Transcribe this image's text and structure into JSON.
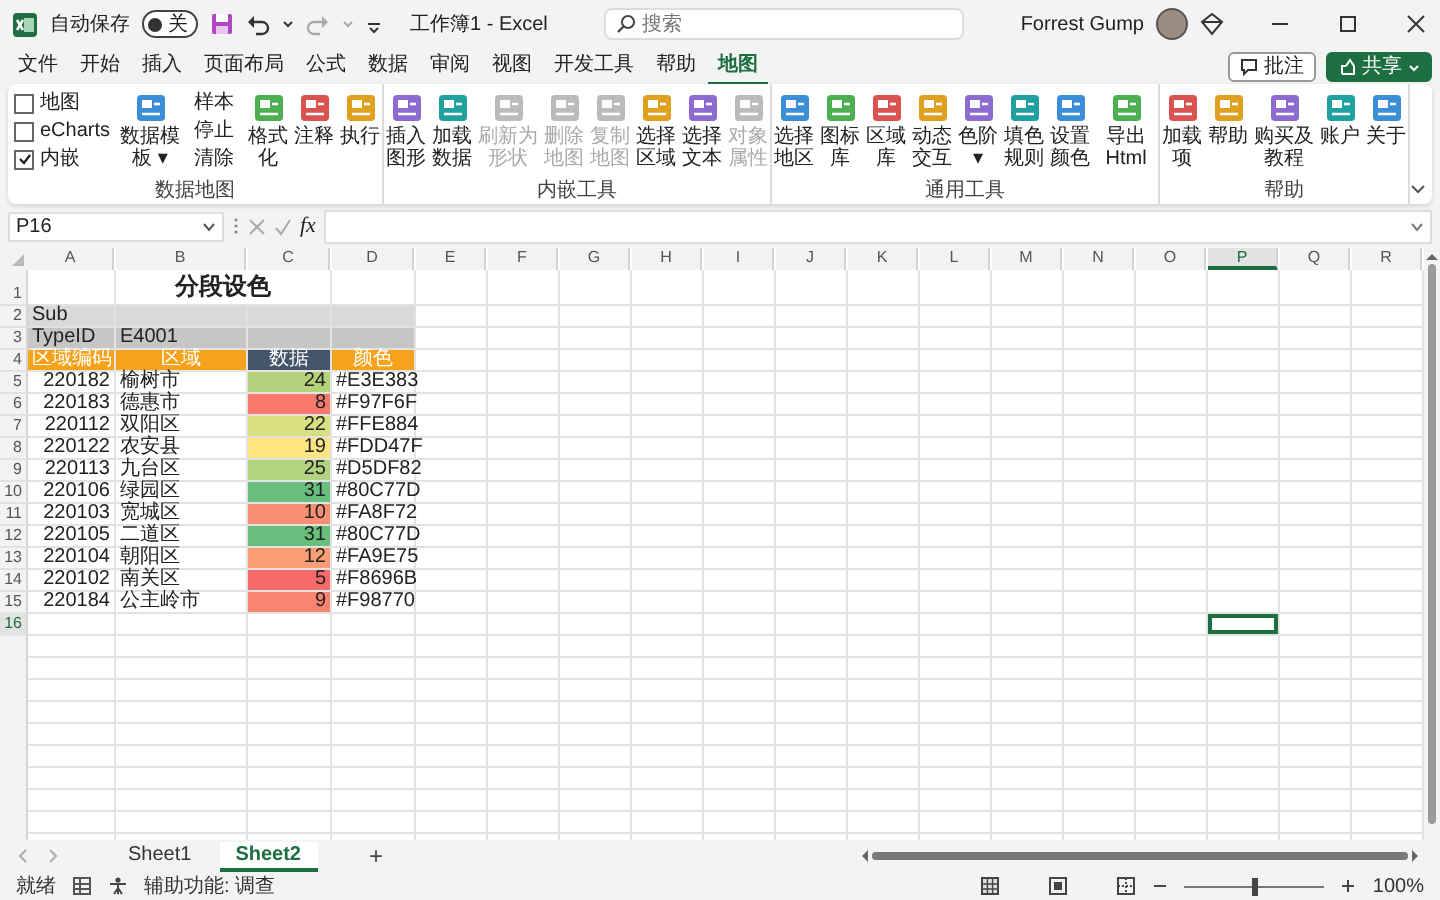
{
  "title_bar": {
    "autosave_label": "自动保存",
    "autosave_state": "关",
    "autosave_on": false,
    "document_title": "工作簿1 - Excel",
    "search_placeholder": "搜索",
    "user_name": "Forrest Gump"
  },
  "ribbon_tabs": [
    {
      "label": "文件",
      "selected": false
    },
    {
      "label": "开始",
      "selected": false
    },
    {
      "label": "插入",
      "selected": false
    },
    {
      "label": "页面布局",
      "selected": false
    },
    {
      "label": "公式",
      "selected": false
    },
    {
      "label": "数据",
      "selected": false
    },
    {
      "label": "审阅",
      "selected": false
    },
    {
      "label": "视图",
      "selected": false
    },
    {
      "label": "开发工具",
      "selected": false
    },
    {
      "label": "帮助",
      "selected": false
    },
    {
      "label": "地图",
      "selected": true
    }
  ],
  "ribbon_actions": [
    {
      "label": "批注",
      "kind": "outline"
    },
    {
      "label": "共享",
      "kind": "primary"
    }
  ],
  "ribbon_groups": [
    {
      "label": "数据地图",
      "items": [
        {
          "kind": "checkbox",
          "label": "地图",
          "checked": false
        },
        {
          "kind": "checkbox",
          "label": "eCharts",
          "checked": false
        },
        {
          "kind": "checkbox",
          "label": "内嵌",
          "checked": true
        },
        {
          "kind": "large",
          "label": "数据模板 ▾",
          "disabled": false
        },
        {
          "kind": "small",
          "label": "样本",
          "disabled": false
        },
        {
          "kind": "small",
          "label": "停止",
          "disabled": false
        },
        {
          "kind": "small",
          "label": "清除",
          "disabled": false
        },
        {
          "kind": "large",
          "label": "格式化",
          "disabled": false
        },
        {
          "kind": "large",
          "label": "注释",
          "disabled": false
        },
        {
          "kind": "large",
          "label": "执行",
          "disabled": false
        }
      ]
    },
    {
      "label": "内嵌工具",
      "items": [
        {
          "kind": "large",
          "label": "插入图形",
          "disabled": false
        },
        {
          "kind": "large",
          "label": "加载数据",
          "disabled": false
        },
        {
          "kind": "large",
          "label": "刷新为形状",
          "disabled": true
        },
        {
          "kind": "large",
          "label": "删除地图",
          "disabled": true
        },
        {
          "kind": "large",
          "label": "复制地图",
          "disabled": true
        },
        {
          "kind": "large",
          "label": "选择区域",
          "disabled": false
        },
        {
          "kind": "large",
          "label": "选择文本",
          "disabled": false
        },
        {
          "kind": "large",
          "label": "对象属性",
          "disabled": true
        }
      ]
    },
    {
      "label": "通用工具",
      "items": [
        {
          "kind": "large",
          "label": "选择地区",
          "disabled": false
        },
        {
          "kind": "large",
          "label": "图标库",
          "disabled": false
        },
        {
          "kind": "large",
          "label": "区域库",
          "disabled": false
        },
        {
          "kind": "large",
          "label": "动态交互",
          "disabled": false
        },
        {
          "kind": "large",
          "label": "色阶 ▾",
          "disabled": false
        },
        {
          "kind": "large",
          "label": "填色规则",
          "disabled": false
        },
        {
          "kind": "large",
          "label": "设置颜色",
          "disabled": false
        },
        {
          "kind": "large",
          "label": "导出Html",
          "disabled": false
        }
      ]
    },
    {
      "label": "帮助",
      "items": [
        {
          "kind": "large",
          "label": "加载项",
          "disabled": false
        },
        {
          "kind": "large",
          "label": "帮助",
          "disabled": false
        },
        {
          "kind": "large",
          "label": "购买及教程",
          "disabled": false
        },
        {
          "kind": "large",
          "label": "账户",
          "disabled": false
        },
        {
          "kind": "large",
          "label": "关于",
          "disabled": false
        }
      ]
    }
  ],
  "formula_bar": {
    "name_box": "P16",
    "function_label": "fx"
  },
  "sheet": {
    "columns": [
      {
        "label": "A",
        "selected": false
      },
      {
        "label": "B",
        "selected": false
      },
      {
        "label": "C",
        "selected": false
      },
      {
        "label": "D",
        "selected": false
      },
      {
        "label": "E",
        "selected": false
      },
      {
        "label": "F",
        "selected": false
      },
      {
        "label": "G",
        "selected": false
      },
      {
        "label": "H",
        "selected": false
      },
      {
        "label": "I",
        "selected": false
      },
      {
        "label": "J",
        "selected": false
      },
      {
        "label": "K",
        "selected": false
      },
      {
        "label": "L",
        "selected": false
      },
      {
        "label": "M",
        "selected": false
      },
      {
        "label": "N",
        "selected": false
      },
      {
        "label": "O",
        "selected": false
      },
      {
        "label": "P",
        "selected": true
      },
      {
        "label": "Q",
        "selected": false
      },
      {
        "label": "R",
        "selected": false
      }
    ],
    "rows": [
      {
        "number": "1",
        "kind": "title",
        "selected": false,
        "title": "分段设色"
      },
      {
        "number": "2",
        "kind": "band",
        "selected": false,
        "color": "#d9d9d9",
        "cells": [
          "Sub"
        ]
      },
      {
        "number": "3",
        "kind": "band",
        "selected": false,
        "color": "#c6c6c6",
        "cells": [
          "TypeID",
          "E4001"
        ]
      },
      {
        "number": "4",
        "kind": "header",
        "selected": false,
        "cells": [
          {
            "text": "区域编码",
            "color": "#f7a21b"
          },
          {
            "text": "区域",
            "color": "#f7a21b"
          },
          {
            "text": "数据",
            "color": "#44546a"
          },
          {
            "text": "颜色",
            "color": "#f7a21b"
          }
        ]
      },
      {
        "number": "5",
        "kind": "data",
        "selected": false,
        "code": "220182",
        "region": "榆树市",
        "value": "24",
        "color": "#b4d27b",
        "hex": "#E3E383"
      },
      {
        "number": "6",
        "kind": "data",
        "selected": false,
        "code": "220183",
        "region": "德惠市",
        "value": "8",
        "color": "#f8796c",
        "hex": "#F97F6F"
      },
      {
        "number": "7",
        "kind": "data",
        "selected": false,
        "code": "220112",
        "region": "双阳区",
        "value": "22",
        "color": "#d9e082",
        "hex": "#FFE884"
      },
      {
        "number": "8",
        "kind": "data",
        "selected": false,
        "code": "220122",
        "region": "农安县",
        "value": "19",
        "color": "#fde582",
        "hex": "#FDD47F"
      },
      {
        "number": "9",
        "kind": "data",
        "selected": false,
        "code": "220113",
        "region": "九台区",
        "value": "25",
        "color": "#b2d480",
        "hex": "#D5DF82"
      },
      {
        "number": "10",
        "kind": "data",
        "selected": false,
        "code": "220106",
        "region": "绿园区",
        "value": "31",
        "color": "#68bf7c",
        "hex": "#80C77D"
      },
      {
        "number": "11",
        "kind": "data",
        "selected": false,
        "code": "220103",
        "region": "宽城区",
        "value": "10",
        "color": "#f98e72",
        "hex": "#FA8F72"
      },
      {
        "number": "12",
        "kind": "data",
        "selected": false,
        "code": "220105",
        "region": "二道区",
        "value": "31",
        "color": "#69c07d",
        "hex": "#80C77D"
      },
      {
        "number": "13",
        "kind": "data",
        "selected": false,
        "code": "220104",
        "region": "朝阳区",
        "value": "12",
        "color": "#fa9d75",
        "hex": "#FA9E75"
      },
      {
        "number": "14",
        "kind": "data",
        "selected": false,
        "code": "220102",
        "region": "南关区",
        "value": "5",
        "color": "#f8696b",
        "hex": "#F8696B"
      },
      {
        "number": "15",
        "kind": "data",
        "selected": false,
        "code": "220184",
        "region": "公主岭市",
        "value": "9",
        "color": "#f98570",
        "hex": "#F98770"
      },
      {
        "number": "16",
        "kind": "empty",
        "selected": true
      }
    ]
  },
  "sheet_tabs": [
    {
      "label": "Sheet1",
      "selected": false
    },
    {
      "label": "Sheet2",
      "selected": true
    }
  ],
  "add_sheet": "+",
  "status_bar": {
    "ready": "就绪",
    "accessibility": "辅助功能: 调查",
    "zoom": "100%",
    "level": 0.5
  }
}
